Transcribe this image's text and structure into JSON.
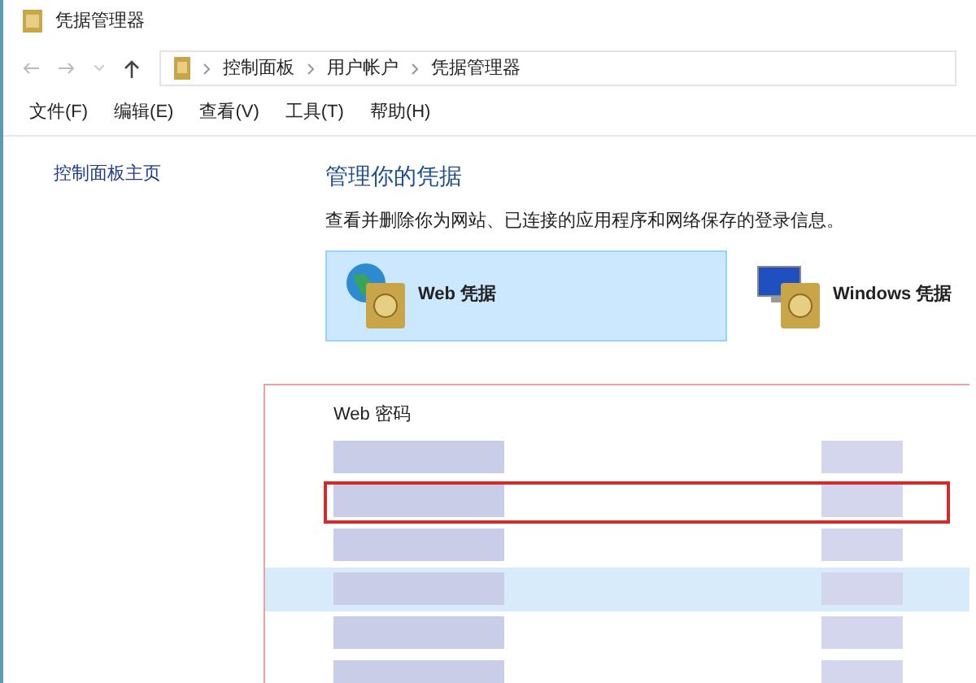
{
  "window": {
    "title": "凭据管理器"
  },
  "address_bar": {
    "breadcrumbs": [
      "控制面板",
      "用户帐户",
      "凭据管理器"
    ]
  },
  "menu": [
    "文件(F)",
    "编辑(E)",
    "查看(V)",
    "工具(T)",
    "帮助(H)"
  ],
  "sidebar": {
    "link": "控制面板主页"
  },
  "heading": "管理你的凭据",
  "description": "查看并删除你为网站、已连接的应用程序和网络保存的登录信息。",
  "tiles": [
    {
      "kind": "web",
      "label": "Web 凭据",
      "selected": true
    },
    {
      "kind": "windows",
      "label": "Windows 凭据",
      "selected": false
    }
  ],
  "section": {
    "title": "Web 密码",
    "rows": [
      {
        "selected": false,
        "highlighted": false
      },
      {
        "selected": false,
        "highlighted": true
      },
      {
        "selected": false,
        "highlighted": false
      },
      {
        "selected": true,
        "highlighted": false
      },
      {
        "selected": false,
        "highlighted": false
      },
      {
        "selected": false,
        "highlighted": false
      }
    ]
  }
}
